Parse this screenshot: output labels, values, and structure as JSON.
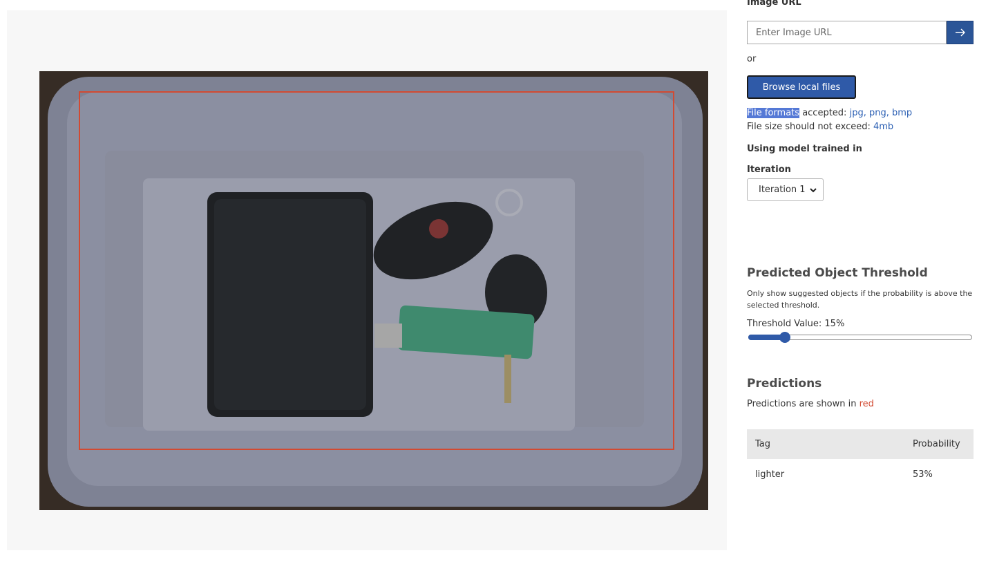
{
  "image_url": {
    "label": "Image URL",
    "placeholder": "Enter Image URL",
    "submit_icon": "arrow-right-icon"
  },
  "or_text": "or",
  "browse_label": "Browse local files",
  "formats": {
    "prefix": "File formats",
    "middle": "accepted:",
    "list": "jpg, png, bmp"
  },
  "size": {
    "text": "File size should not exceed:",
    "value": "4mb"
  },
  "model_label": "Using model trained in",
  "iteration": {
    "label": "Iteration",
    "selected": "Iteration 1"
  },
  "threshold": {
    "title": "Predicted Object Threshold",
    "description": "Only show suggested objects if the probability is above the selected threshold.",
    "value_text": "Threshold Value: 15%",
    "value": 0.15
  },
  "predictions": {
    "title": "Predictions",
    "note_prefix": "Predictions are shown in",
    "note_color_word": "red",
    "columns": [
      "Tag",
      "Probability"
    ],
    "rows": [
      {
        "tag": "lighter",
        "probability": "53%"
      }
    ]
  },
  "colors": {
    "accent": "#2f5aa8",
    "prediction": "#d24a32",
    "link": "#2b5fb3"
  }
}
